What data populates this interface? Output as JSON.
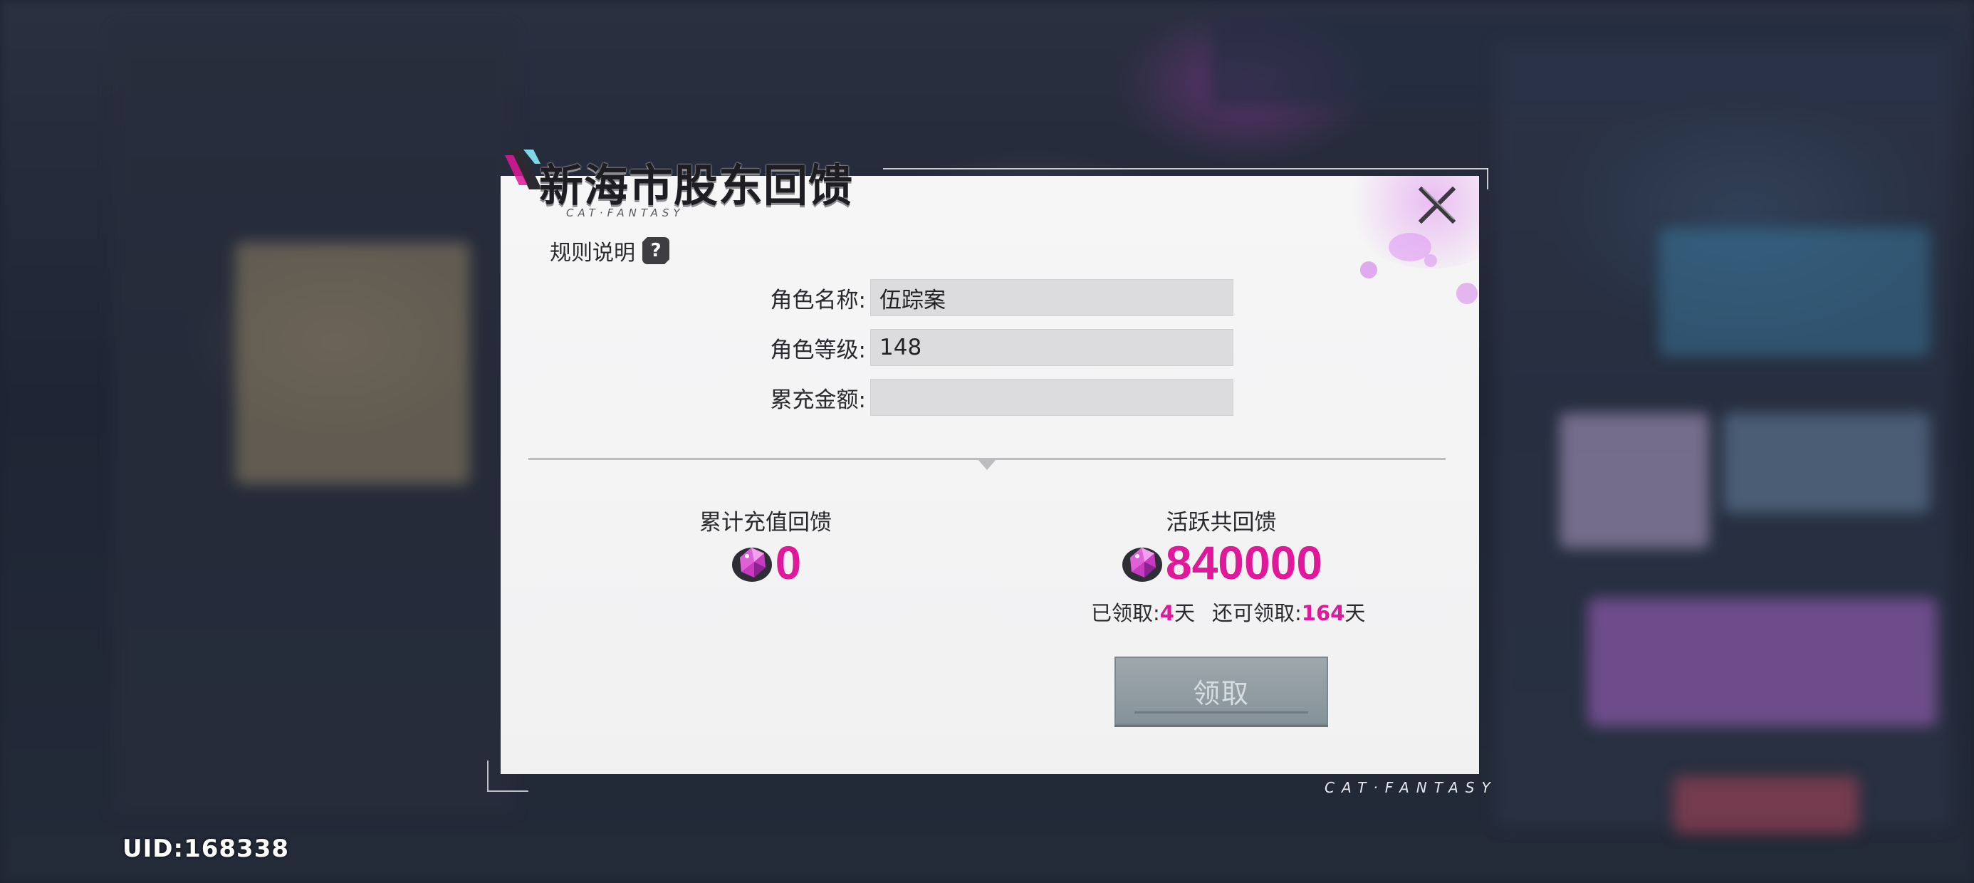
{
  "uid": "UID:168338",
  "dialog": {
    "title": "新海市股东回馈",
    "title_sub": "CAT·FANTASY",
    "rules_label": "规则说明",
    "help_glyph": "?",
    "close_icon": "close-icon",
    "form": [
      {
        "label": "角色名称:",
        "value": "伍踪案"
      },
      {
        "label": "角色等级:",
        "value": "148"
      },
      {
        "label": "累充金额:",
        "value": ""
      }
    ],
    "recharge_reward": {
      "heading": "累计充值回馈",
      "value": "0",
      "icon": "gem-icon"
    },
    "active_reward": {
      "heading": "活跃共回馈",
      "value": "840000",
      "icon": "gem-icon"
    },
    "days": {
      "claimed_label": "已领取:",
      "claimed_value": "4",
      "claimed_unit": "天",
      "remaining_label": "还可领取:",
      "remaining_value": "164",
      "remaining_unit": "天"
    },
    "claim_button": "领取",
    "brand": "CAT·FANTASY"
  },
  "colors": {
    "accent": "#e0189a",
    "panel": "#f4f4f5",
    "button": "#8e9aa1"
  }
}
